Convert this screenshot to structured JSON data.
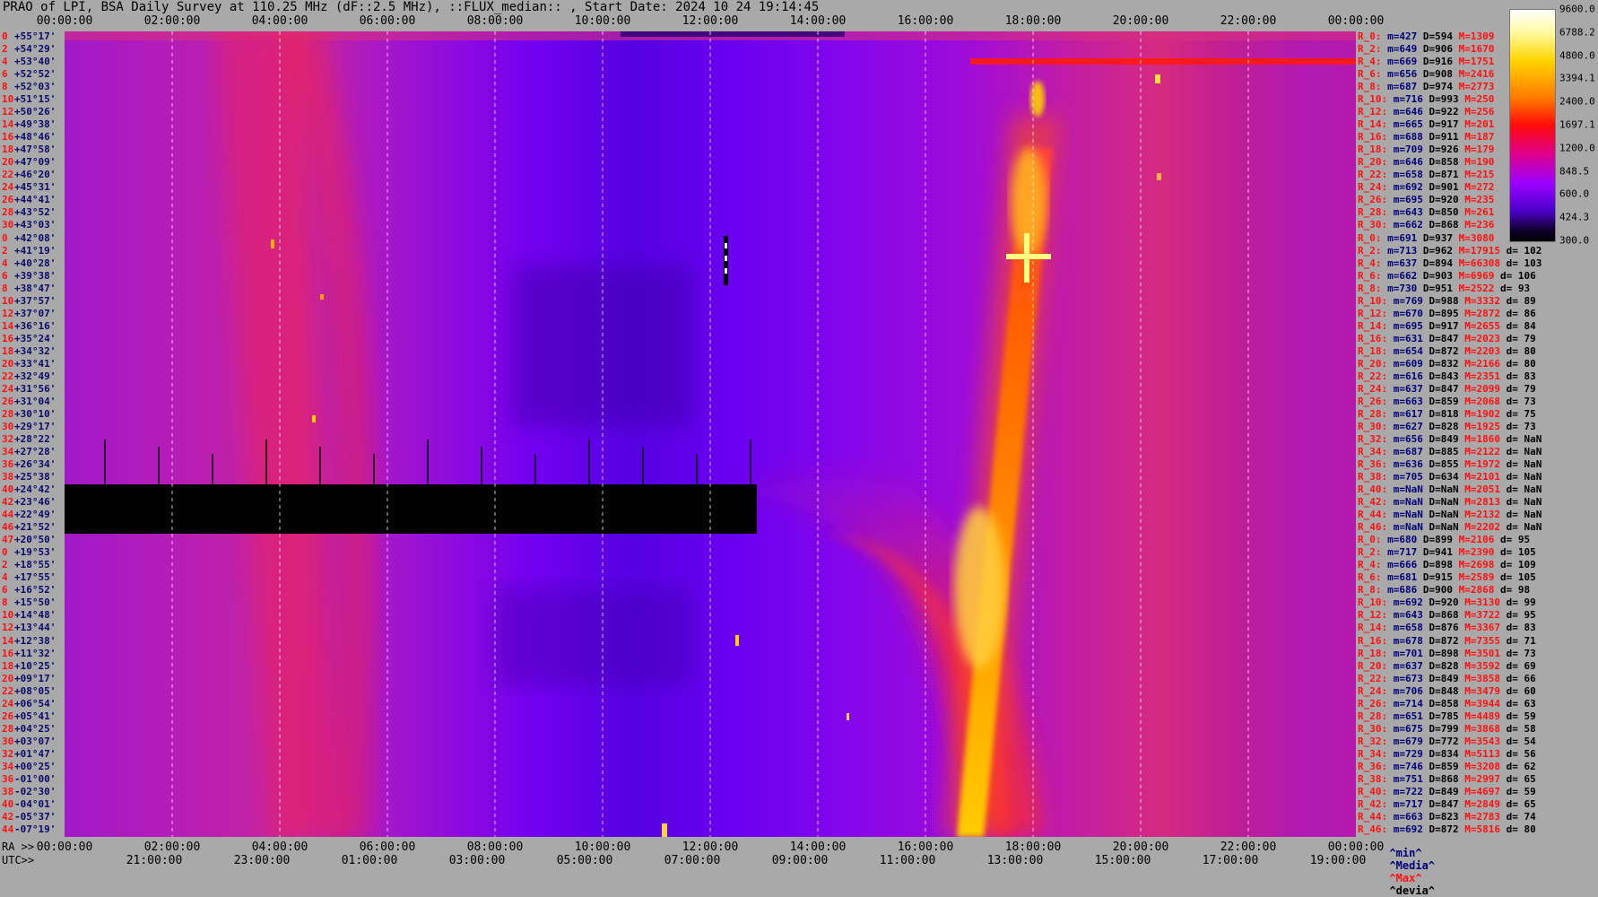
{
  "title": "PRAO of LPI, BSA Daily Survey at 110.25 MHz (dF::2.5 MHz), ::FLUX_median:: , Start Date: 2024 10 24 19:14:45",
  "chart_data": {
    "type": "heatmap",
    "title": "PRAO of LPI, BSA Daily Survey at 110.25 MHz (dF::2.5 MHz), ::FLUX_median:: , Start Date: 2024 10 24 19:14:45",
    "x_top_ticks": [
      "00:00:00",
      "02:00:00",
      "04:00:00",
      "06:00:00",
      "08:00:00",
      "10:00:00",
      "12:00:00",
      "14:00:00",
      "16:00:00",
      "18:00:00",
      "20:00:00",
      "22:00:00",
      "00:00:00"
    ],
    "x_bottom_ra_ticks": [
      "00:00:00",
      "02:00:00",
      "04:00:00",
      "06:00:00",
      "08:00:00",
      "10:00:00",
      "12:00:00",
      "14:00:00",
      "16:00:00",
      "18:00:00",
      "20:00:00",
      "22:00:00",
      "00:00:00"
    ],
    "x_bottom_utc_ticks": [
      "21:00:00",
      "23:00:00",
      "01:00:00",
      "03:00:00",
      "05:00:00",
      "07:00:00",
      "09:00:00",
      "11:00:00",
      "13:00:00",
      "15:00:00",
      "17:00:00",
      "19:00:00"
    ],
    "ra_label": "RA >>",
    "utc_label": "UTC>>",
    "colorbar_ticks": [
      "9600.0",
      "6788.2",
      "4800.0",
      "3394.1",
      "2400.0",
      "1697.1",
      "1200.0",
      "848.5",
      "600.0",
      "424.3",
      "300.0"
    ],
    "colorbar_range": [
      300,
      9600
    ],
    "colorbar_scale": "log",
    "colormap": [
      "#000000",
      "#100030",
      "#4a00c8",
      "#9b00ff",
      "#e0008a",
      "#ff0a0a",
      "#ff7a00",
      "#ffd400",
      "#fffaa0",
      "#ffffff"
    ],
    "declinations": [
      {
        "i": "0",
        "dec": "+55°17'"
      },
      {
        "i": "2",
        "dec": "+54°29'"
      },
      {
        "i": "4",
        "dec": "+53°40'"
      },
      {
        "i": "6",
        "dec": "+52°52'"
      },
      {
        "i": "8",
        "dec": "+52°03'"
      },
      {
        "i": "10",
        "dec": "+51°15'"
      },
      {
        "i": "12",
        "dec": "+50°26'"
      },
      {
        "i": "14",
        "dec": "+49°38'"
      },
      {
        "i": "16",
        "dec": "+48°46'"
      },
      {
        "i": "18",
        "dec": "+47°58'"
      },
      {
        "i": "20",
        "dec": "+47°09'"
      },
      {
        "i": "22",
        "dec": "+46°20'"
      },
      {
        "i": "24",
        "dec": "+45°31'"
      },
      {
        "i": "26",
        "dec": "+44°41'"
      },
      {
        "i": "28",
        "dec": "+43°52'"
      },
      {
        "i": "30",
        "dec": "+43°03'"
      },
      {
        "i": "0",
        "dec": "+42°08'"
      },
      {
        "i": "2",
        "dec": "+41°19'"
      },
      {
        "i": "4",
        "dec": "+40°28'"
      },
      {
        "i": "6",
        "dec": "+39°38'"
      },
      {
        "i": "8",
        "dec": "+38°47'"
      },
      {
        "i": "10",
        "dec": "+37°57'"
      },
      {
        "i": "12",
        "dec": "+37°07'"
      },
      {
        "i": "14",
        "dec": "+36°16'"
      },
      {
        "i": "16",
        "dec": "+35°24'"
      },
      {
        "i": "18",
        "dec": "+34°32'"
      },
      {
        "i": "20",
        "dec": "+33°41'"
      },
      {
        "i": "22",
        "dec": "+32°49'"
      },
      {
        "i": "24",
        "dec": "+31°56'"
      },
      {
        "i": "26",
        "dec": "+31°04'"
      },
      {
        "i": "28",
        "dec": "+30°10'"
      },
      {
        "i": "30",
        "dec": "+29°17'"
      },
      {
        "i": "32",
        "dec": "+28°22'"
      },
      {
        "i": "34",
        "dec": "+27°28'"
      },
      {
        "i": "36",
        "dec": "+26°34'"
      },
      {
        "i": "38",
        "dec": "+25°38'"
      },
      {
        "i": "40",
        "dec": "+24°42'"
      },
      {
        "i": "42",
        "dec": "+23°46'"
      },
      {
        "i": "44",
        "dec": "+22°49'"
      },
      {
        "i": "46",
        "dec": "+21°52'"
      },
      {
        "i": "47",
        "dec": "+20°50'"
      },
      {
        "i": "0",
        "dec": "+19°53'"
      },
      {
        "i": "2",
        "dec": "+18°55'"
      },
      {
        "i": "4",
        "dec": "+17°55'"
      },
      {
        "i": "6",
        "dec": "+16°52'"
      },
      {
        "i": "8",
        "dec": "+15°50'"
      },
      {
        "i": "10",
        "dec": "+14°48'"
      },
      {
        "i": "12",
        "dec": "+13°44'"
      },
      {
        "i": "14",
        "dec": "+12°38'"
      },
      {
        "i": "16",
        "dec": "+11°32'"
      },
      {
        "i": "18",
        "dec": "+10°25'"
      },
      {
        "i": "20",
        "dec": "+09°17'"
      },
      {
        "i": "22",
        "dec": "+08°05'"
      },
      {
        "i": "24",
        "dec": "+06°54'"
      },
      {
        "i": "26",
        "dec": "+05°41'"
      },
      {
        "i": "28",
        "dec": "+04°25'"
      },
      {
        "i": "30",
        "dec": "+03°07'"
      },
      {
        "i": "32",
        "dec": "+01°47'"
      },
      {
        "i": "34",
        "dec": "+00°25'"
      },
      {
        "i": "36",
        "dec": "-01°00'"
      },
      {
        "i": "38",
        "dec": "-02°30'"
      },
      {
        "i": "40",
        "dec": "-04°01'"
      },
      {
        "i": "42",
        "dec": "-05°37'"
      },
      {
        "i": "44",
        "dec": "-07°19'"
      }
    ],
    "stats": [
      {
        "r": "R_0:",
        "m": "m=427",
        "d": "D=594",
        "M": "M=1309",
        "dev": ""
      },
      {
        "r": "R_2:",
        "m": "m=649",
        "d": "D=906",
        "M": "M=1670",
        "dev": ""
      },
      {
        "r": "R_4:",
        "m": "m=669",
        "d": "D=916",
        "M": "M=1751",
        "dev": ""
      },
      {
        "r": "R_6:",
        "m": "m=656",
        "d": "D=908",
        "M": "M=2416",
        "dev": ""
      },
      {
        "r": "R_8:",
        "m": "m=687",
        "d": "D=974",
        "M": "M=2773",
        "dev": ""
      },
      {
        "r": "R_10:",
        "m": "m=716",
        "d": "D=993",
        "M": "M=250",
        "dev": ""
      },
      {
        "r": "R_12:",
        "m": "m=646",
        "d": "D=922",
        "M": "M=256",
        "dev": ""
      },
      {
        "r": "R_14:",
        "m": "m=665",
        "d": "D=917",
        "M": "M=201",
        "dev": ""
      },
      {
        "r": "R_16:",
        "m": "m=688",
        "d": "D=911",
        "M": "M=187",
        "dev": ""
      },
      {
        "r": "R_18:",
        "m": "m=709",
        "d": "D=926",
        "M": "M=179",
        "dev": ""
      },
      {
        "r": "R_20:",
        "m": "m=646",
        "d": "D=858",
        "M": "M=190",
        "dev": ""
      },
      {
        "r": "R_22:",
        "m": "m=658",
        "d": "D=871",
        "M": "M=215",
        "dev": ""
      },
      {
        "r": "R_24:",
        "m": "m=692",
        "d": "D=901",
        "M": "M=272",
        "dev": ""
      },
      {
        "r": "R_26:",
        "m": "m=695",
        "d": "D=920",
        "M": "M=235",
        "dev": ""
      },
      {
        "r": "R_28:",
        "m": "m=643",
        "d": "D=850",
        "M": "M=261",
        "dev": ""
      },
      {
        "r": "R_30:",
        "m": "m=662",
        "d": "D=868",
        "M": "M=236",
        "dev": ""
      },
      {
        "r": "R_0:",
        "m": "m=691",
        "d": "D=937",
        "M": "M=3080",
        "dev": ""
      },
      {
        "r": "R_2:",
        "m": "m=713",
        "d": "D=962",
        "M": "M=17915",
        "dev": "d= 102"
      },
      {
        "r": "R_4:",
        "m": "m=637",
        "d": "D=894",
        "M": "M=66308",
        "dev": "d= 103"
      },
      {
        "r": "R_6:",
        "m": "m=662",
        "d": "D=903",
        "M": "M=6969",
        "dev": "d= 106"
      },
      {
        "r": "R_8:",
        "m": "m=730",
        "d": "D=951",
        "M": "M=2522",
        "dev": "d= 93"
      },
      {
        "r": "R_10:",
        "m": "m=769",
        "d": "D=988",
        "M": "M=3332",
        "dev": "d= 89"
      },
      {
        "r": "R_12:",
        "m": "m=670",
        "d": "D=895",
        "M": "M=2872",
        "dev": "d= 86"
      },
      {
        "r": "R_14:",
        "m": "m=695",
        "d": "D=917",
        "M": "M=2655",
        "dev": "d= 84"
      },
      {
        "r": "R_16:",
        "m": "m=631",
        "d": "D=847",
        "M": "M=2023",
        "dev": "d= 79"
      },
      {
        "r": "R_18:",
        "m": "m=654",
        "d": "D=872",
        "M": "M=2203",
        "dev": "d= 80"
      },
      {
        "r": "R_20:",
        "m": "m=609",
        "d": "D=832",
        "M": "M=2166",
        "dev": "d= 80"
      },
      {
        "r": "R_22:",
        "m": "m=616",
        "d": "D=843",
        "M": "M=2351",
        "dev": "d= 83"
      },
      {
        "r": "R_24:",
        "m": "m=637",
        "d": "D=847",
        "M": "M=2099",
        "dev": "d= 79"
      },
      {
        "r": "R_26:",
        "m": "m=663",
        "d": "D=859",
        "M": "M=2068",
        "dev": "d= 73"
      },
      {
        "r": "R_28:",
        "m": "m=617",
        "d": "D=818",
        "M": "M=1902",
        "dev": "d= 75"
      },
      {
        "r": "R_30:",
        "m": "m=627",
        "d": "D=828",
        "M": "M=1925",
        "dev": "d= 73"
      },
      {
        "r": "R_32:",
        "m": "m=656",
        "d": "D=849",
        "M": "M=1860",
        "dev": "d= NaN"
      },
      {
        "r": "R_34:",
        "m": "m=687",
        "d": "D=885",
        "M": "M=2122",
        "dev": "d= NaN"
      },
      {
        "r": "R_36:",
        "m": "m=636",
        "d": "D=855",
        "M": "M=1972",
        "dev": "d= NaN"
      },
      {
        "r": "R_38:",
        "m": "m=705",
        "d": "D=634",
        "M": "M=2101",
        "dev": "d= NaN"
      },
      {
        "r": "R_40:",
        "m": "m=NaN",
        "d": "D=NaN",
        "M": "M=2051",
        "dev": "d= NaN"
      },
      {
        "r": "R_42:",
        "m": "m=NaN",
        "d": "D=NaN",
        "M": "M=2813",
        "dev": "d= NaN"
      },
      {
        "r": "R_44:",
        "m": "m=NaN",
        "d": "D=NaN",
        "M": "M=2132",
        "dev": "d= NaN"
      },
      {
        "r": "R_46:",
        "m": "m=NaN",
        "d": "D=NaN",
        "M": "M=2202",
        "dev": "d= NaN"
      },
      {
        "r": "R_0:",
        "m": "m=680",
        "d": "D=899",
        "M": "M=2106",
        "dev": "d= 95"
      },
      {
        "r": "R_2:",
        "m": "m=717",
        "d": "D=941",
        "M": "M=2390",
        "dev": "d= 105"
      },
      {
        "r": "R_4:",
        "m": "m=666",
        "d": "D=898",
        "M": "M=2698",
        "dev": "d= 109"
      },
      {
        "r": "R_6:",
        "m": "m=681",
        "d": "D=915",
        "M": "M=2589",
        "dev": "d= 105"
      },
      {
        "r": "R_8:",
        "m": "m=686",
        "d": "D=900",
        "M": "M=2868",
        "dev": "d= 98"
      },
      {
        "r": "R_10:",
        "m": "m=692",
        "d": "D=920",
        "M": "M=3130",
        "dev": "d= 99"
      },
      {
        "r": "R_12:",
        "m": "m=643",
        "d": "D=868",
        "M": "M=3722",
        "dev": "d= 95"
      },
      {
        "r": "R_14:",
        "m": "m=658",
        "d": "D=876",
        "M": "M=3367",
        "dev": "d= 83"
      },
      {
        "r": "R_16:",
        "m": "m=678",
        "d": "D=872",
        "M": "M=7355",
        "dev": "d= 71"
      },
      {
        "r": "R_18:",
        "m": "m=701",
        "d": "D=898",
        "M": "M=3501",
        "dev": "d= 73"
      },
      {
        "r": "R_20:",
        "m": "m=637",
        "d": "D=828",
        "M": "M=3592",
        "dev": "d= 69"
      },
      {
        "r": "R_22:",
        "m": "m=673",
        "d": "D=849",
        "M": "M=3858",
        "dev": "d= 66"
      },
      {
        "r": "R_24:",
        "m": "m=706",
        "d": "D=848",
        "M": "M=3479",
        "dev": "d= 60"
      },
      {
        "r": "R_26:",
        "m": "m=714",
        "d": "D=858",
        "M": "M=3944",
        "dev": "d= 63"
      },
      {
        "r": "R_28:",
        "m": "m=651",
        "d": "D=785",
        "M": "M=4489",
        "dev": "d= 59"
      },
      {
        "r": "R_30:",
        "m": "m=675",
        "d": "D=799",
        "M": "M=3868",
        "dev": "d= 58"
      },
      {
        "r": "R_32:",
        "m": "m=679",
        "d": "D=772",
        "M": "M=3543",
        "dev": "d= 54"
      },
      {
        "r": "R_34:",
        "m": "m=729",
        "d": "D=834",
        "M": "M=5113",
        "dev": "d= 56"
      },
      {
        "r": "R_36:",
        "m": "m=746",
        "d": "D=859",
        "M": "M=3208",
        "dev": "d= 62"
      },
      {
        "r": "R_38:",
        "m": "m=751",
        "d": "D=868",
        "M": "M=2997",
        "dev": "d= 65"
      },
      {
        "r": "R_40:",
        "m": "m=722",
        "d": "D=849",
        "M": "M=4697",
        "dev": "d= 59"
      },
      {
        "r": "R_42:",
        "m": "m=717",
        "d": "D=847",
        "M": "M=2849",
        "dev": "d= 65"
      },
      {
        "r": "R_44:",
        "m": "m=663",
        "d": "D=823",
        "M": "M=2783",
        "dev": "d= 74"
      },
      {
        "r": "R_46:",
        "m": "m=692",
        "d": "D=872",
        "M": "M=5816",
        "dev": "d= 80"
      }
    ],
    "legend": {
      "min": "^min^",
      "median": "^Media^",
      "max": "^Max^",
      "dev": "^devia^"
    }
  }
}
